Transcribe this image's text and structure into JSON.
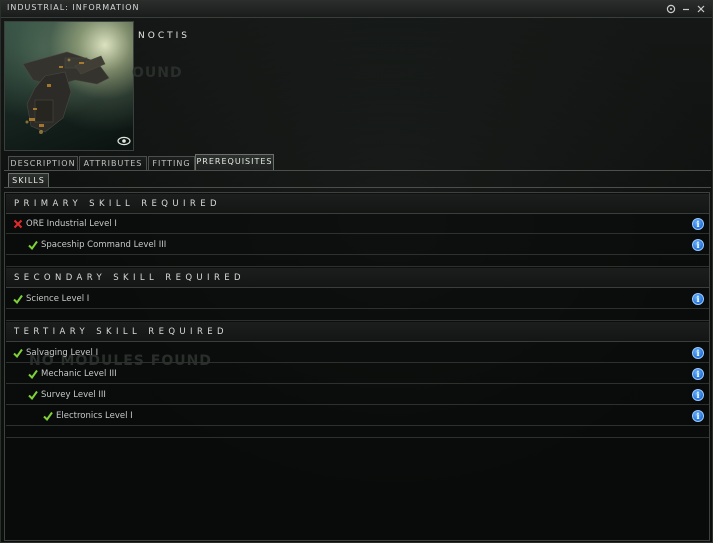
{
  "window": {
    "title": "INDUSTRIAL: INFORMATION",
    "controls": [
      "settings-icon",
      "minimize-icon",
      "close-icon"
    ]
  },
  "ship": {
    "name": "NOCTIS",
    "ghost_text_1": "OUND",
    "ghost_text_2": "NO MODULES FOUND"
  },
  "tabs": [
    {
      "label": "DESCRIPTION"
    },
    {
      "label": "ATTRIBUTES"
    },
    {
      "label": "FITTING"
    },
    {
      "label": "PREREQUISITES",
      "active": true
    }
  ],
  "subtabs": [
    {
      "label": "SKILLS",
      "active": true
    }
  ],
  "sections": [
    {
      "header": "PRIMARY SKILL REQUIRED",
      "rows": [
        {
          "label": "ORE Industrial Level I",
          "status": "missing",
          "indent": 0
        },
        {
          "label": "Spaceship Command Level III",
          "status": "ok",
          "indent": 1
        }
      ]
    },
    {
      "header": "SECONDARY SKILL REQUIRED",
      "rows": [
        {
          "label": "Science Level I",
          "status": "ok",
          "indent": 0
        }
      ]
    },
    {
      "header": "TERTIARY SKILL REQUIRED",
      "rows": [
        {
          "label": "Salvaging Level I",
          "status": "ok",
          "indent": 0
        },
        {
          "label": "Mechanic Level III",
          "status": "ok",
          "indent": 1
        },
        {
          "label": "Survey Level III",
          "status": "ok",
          "indent": 1
        },
        {
          "label": "Electronics Level I",
          "status": "ok",
          "indent": 2
        }
      ]
    }
  ],
  "icons": {
    "missing": "red-x-icon",
    "ok": "green-check-icon",
    "info": "info-icon"
  },
  "colors": {
    "missing": "#e02b2b",
    "ok": "#7fd13a",
    "info": "#2f86f0"
  }
}
